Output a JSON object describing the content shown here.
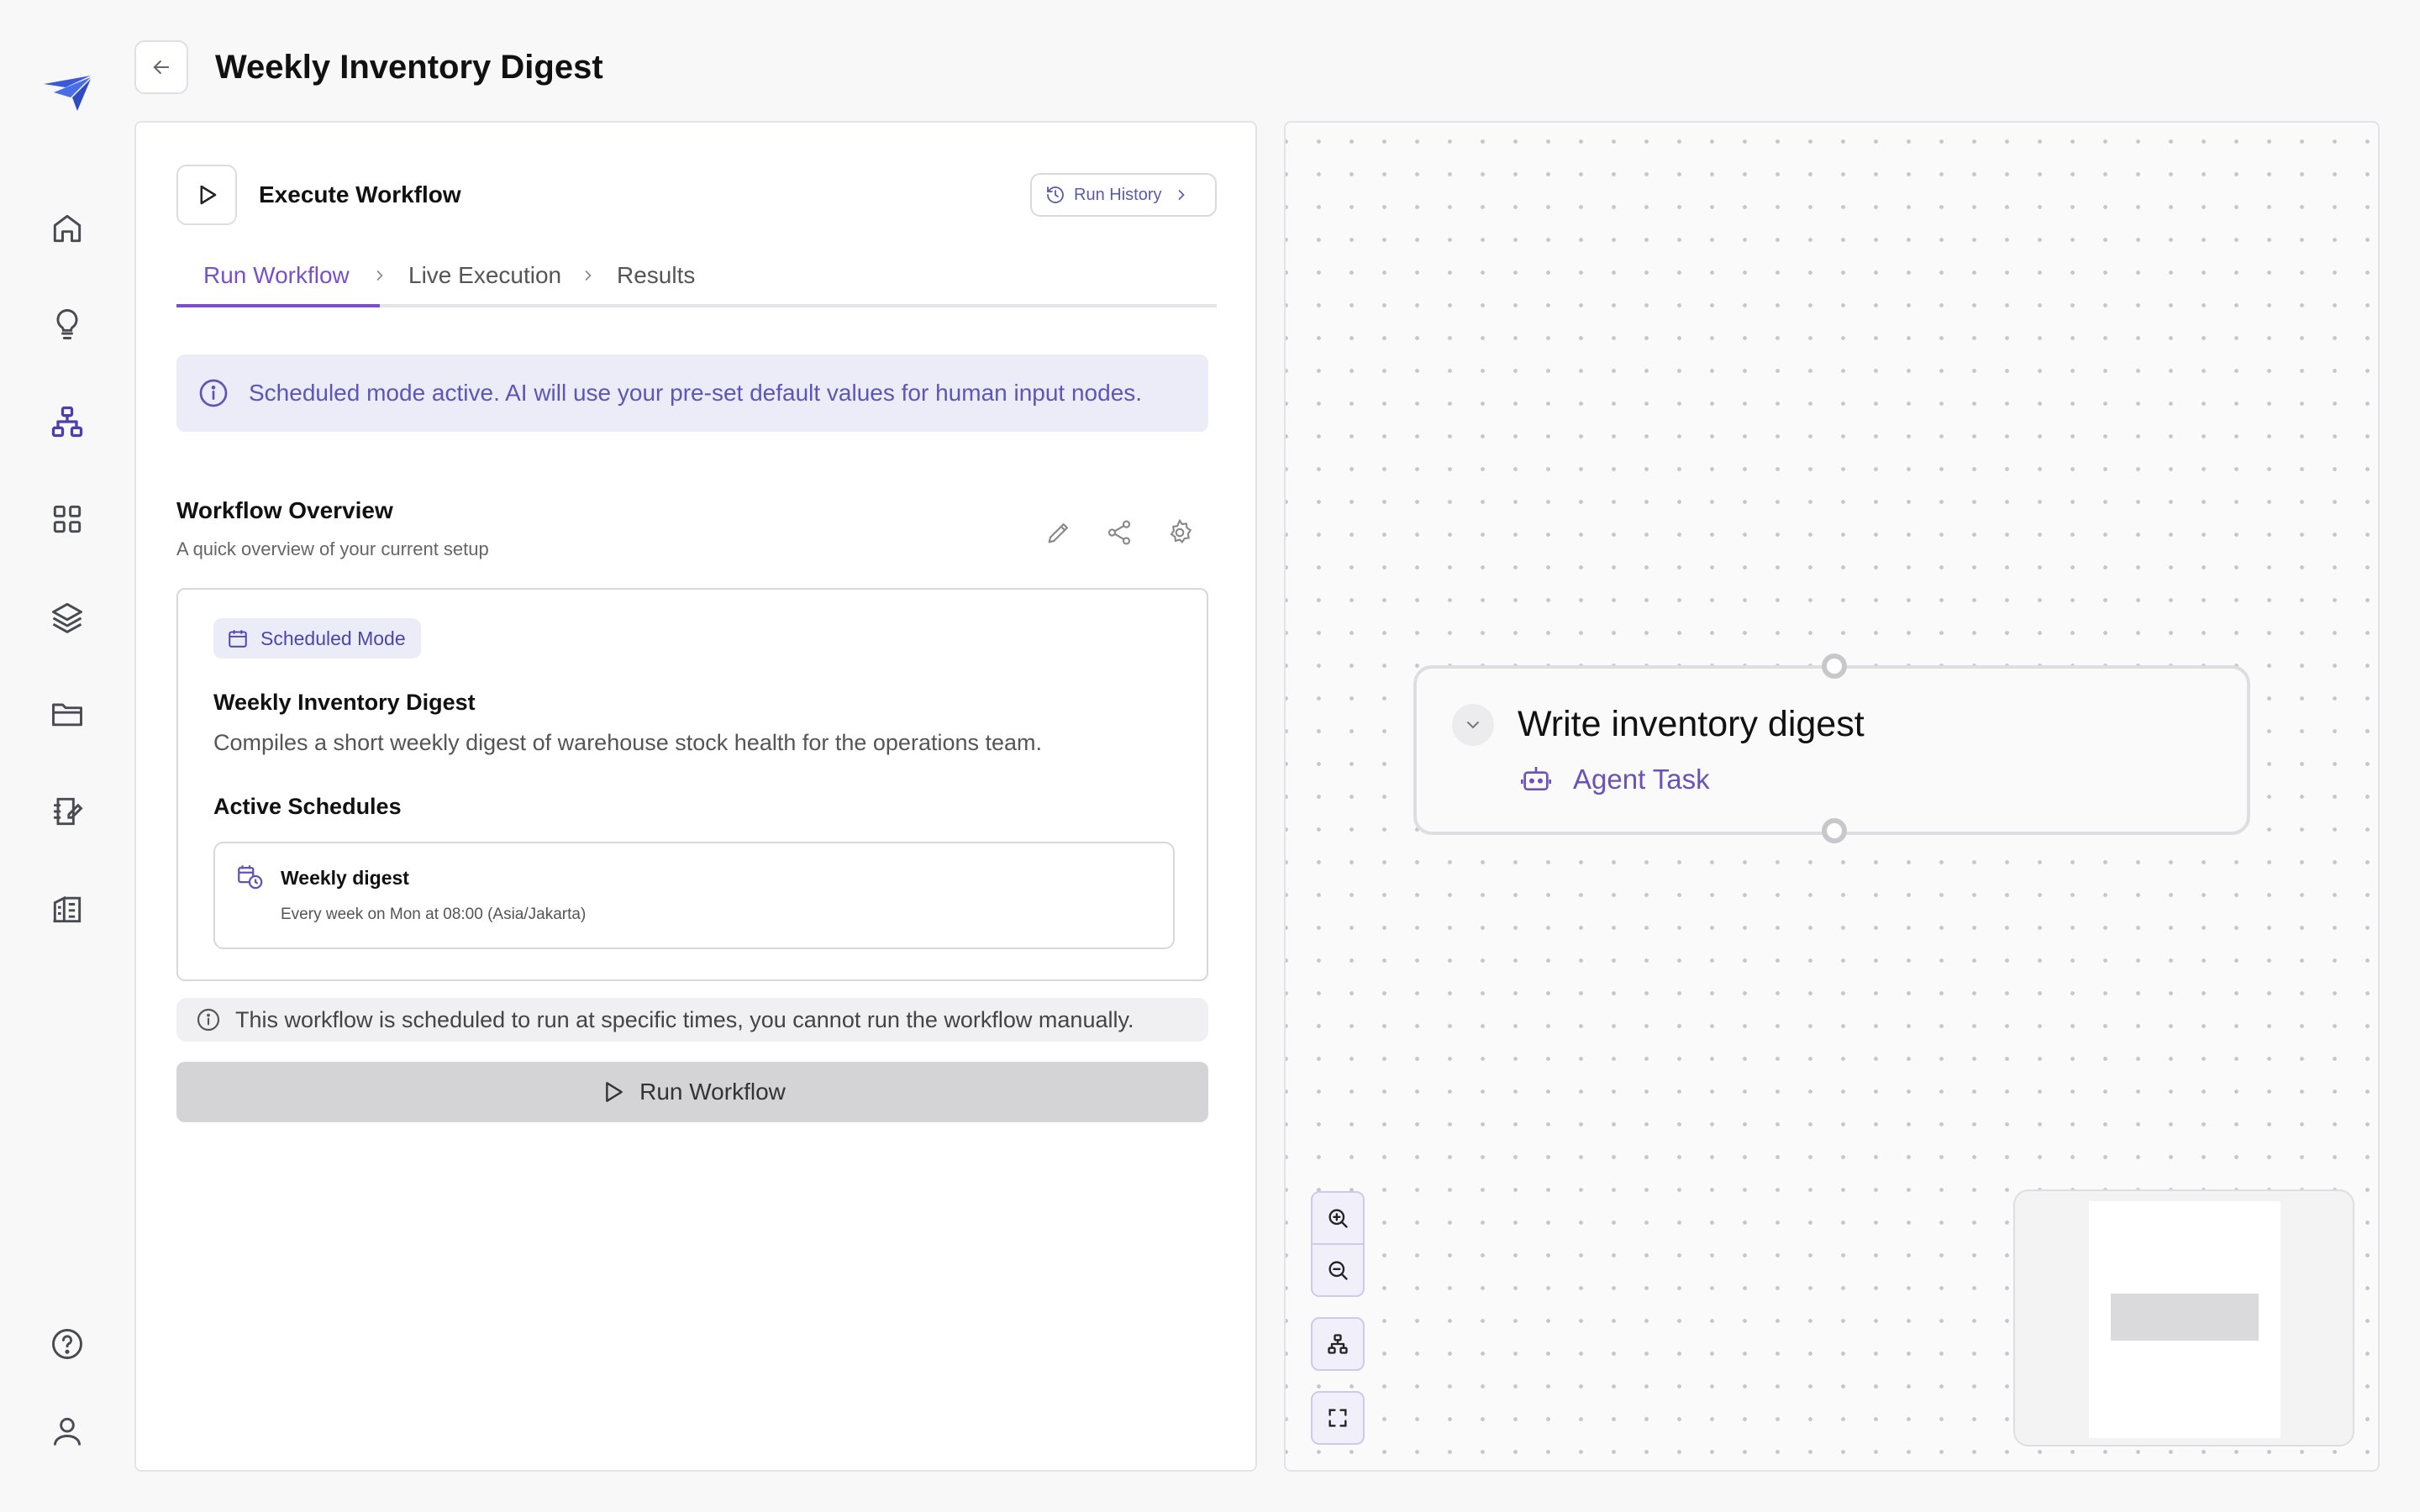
{
  "header": {
    "title": "Weekly Inventory Digest"
  },
  "sidebar": {
    "icons": [
      "logo-icon",
      "home-icon",
      "lightbulb-icon",
      "workflow-icon",
      "grid-icon",
      "layers-icon",
      "folder-icon",
      "notes-icon",
      "building-icon",
      "help-icon",
      "user-icon"
    ],
    "accent": "#3a5ad9"
  },
  "execute": {
    "title": "Execute Workflow",
    "run_history_label": "Run History"
  },
  "tabs": [
    {
      "label": "Run Workflow",
      "active": true
    },
    {
      "label": "Live Execution",
      "active": false
    },
    {
      "label": "Results",
      "active": false
    }
  ],
  "info_banner": "Scheduled mode active. AI will use your pre-set default values for human input nodes.",
  "overview": {
    "title": "Workflow Overview",
    "subtitle": "A quick overview of your current setup",
    "actions": [
      "edit-icon",
      "share-icon",
      "settings-icon"
    ],
    "mode_badge": "Scheduled Mode",
    "workflow_name": "Weekly Inventory Digest",
    "workflow_description": "Compiles a short weekly digest of warehouse stock health for the operations team.",
    "schedules_title": "Active Schedules",
    "schedules": [
      {
        "name": "Weekly digest",
        "when": "Every week on Mon at 08:00 (Asia/Jakarta)"
      }
    ]
  },
  "manual_notice": "This workflow is scheduled to run at specific times, you cannot run the workflow manually.",
  "run_button_label": "Run Workflow",
  "canvas": {
    "node": {
      "title": "Write inventory digest",
      "type_label": "Agent Task"
    },
    "controls": [
      "zoom-in-icon",
      "zoom-out-icon",
      "auto-layout-icon",
      "fit-view-icon"
    ]
  },
  "colors": {
    "accent": "#7a4fc7",
    "banner_bg": "#ecebf8",
    "banner_text": "#5e56b5",
    "disabled_button": "#d4d4d6"
  }
}
